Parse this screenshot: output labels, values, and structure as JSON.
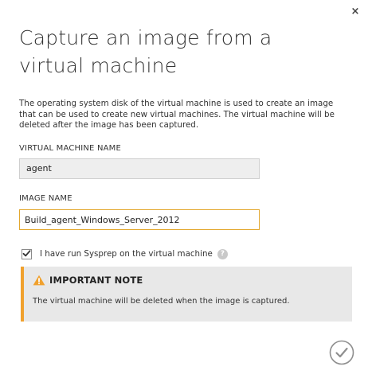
{
  "dialog": {
    "title": "Capture an image from a virtual machine",
    "description": "The operating system disk of the virtual machine is used to create an image that can be used to create new virtual machines. The virtual machine will be deleted after the image has been captured.",
    "close_label": "×"
  },
  "vm_name": {
    "label": "VIRTUAL MACHINE NAME",
    "value": "agent"
  },
  "image_name": {
    "label": "IMAGE NAME",
    "value": "Build_agent_Windows_Server_2012"
  },
  "sysprep": {
    "label": "I have run Sysprep on the virtual machine",
    "checked": true,
    "help_label": "?"
  },
  "note": {
    "title": "IMPORTANT NOTE",
    "text": "The virtual machine will be deleted when the image is captured.",
    "accent_color": "#f0a12e"
  },
  "icons": {
    "close": "close-icon",
    "checkmark": "checkmark-icon",
    "help": "help-icon",
    "warning": "warning-icon",
    "ok": "complete-check-icon"
  }
}
